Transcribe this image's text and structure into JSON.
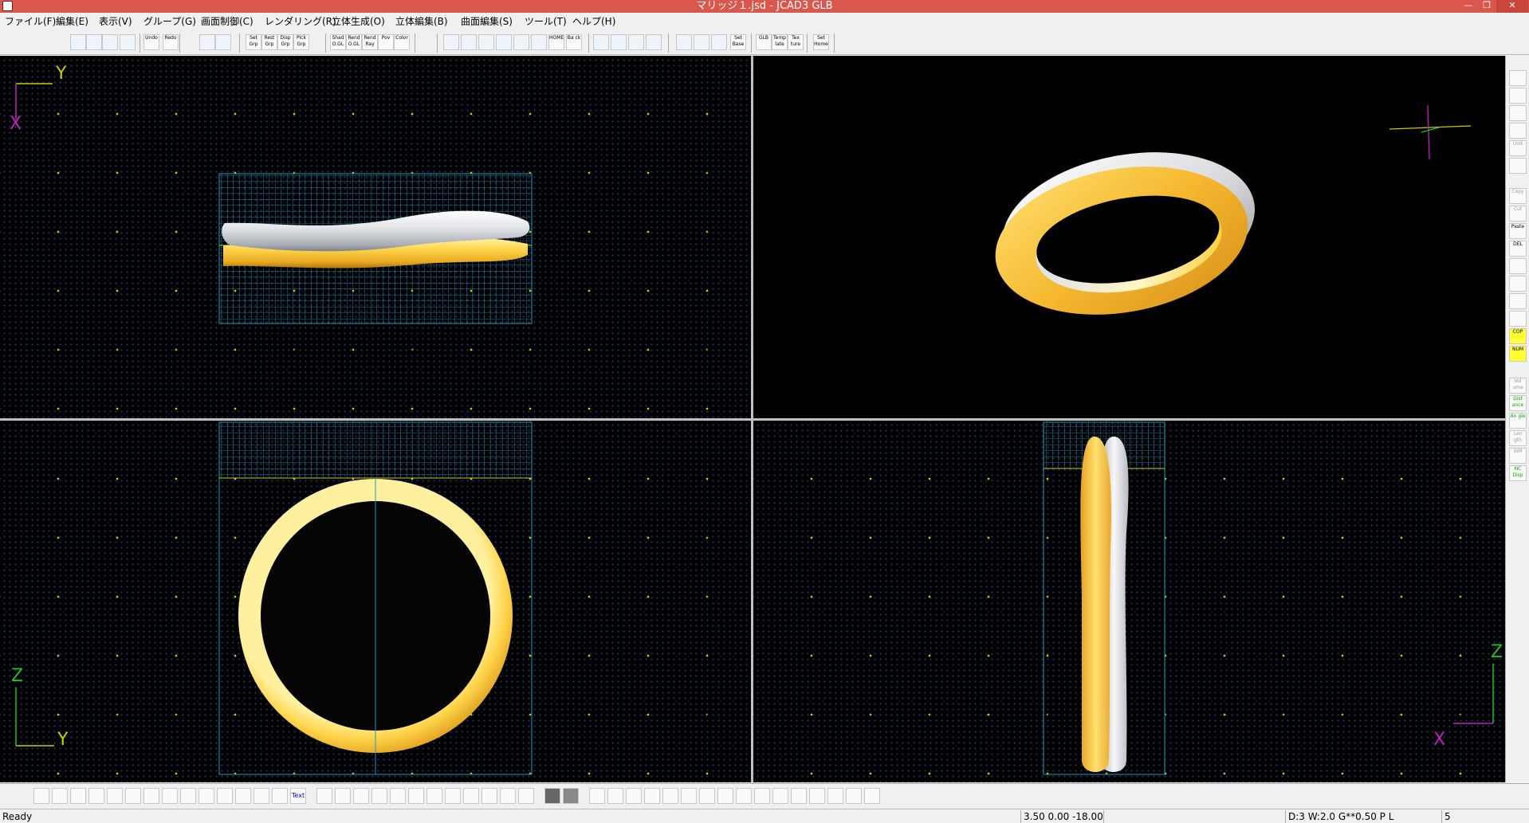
{
  "window": {
    "title": "マリッジ１.jsd - JCAD3 GLB",
    "controls": [
      "—",
      "❐",
      "✕"
    ]
  },
  "menu": [
    "ファイル(F)",
    "編集(E)",
    "表示(V)",
    "グループ(G)",
    "画面制御(C)",
    "レンダリング(R)",
    "立体生成(O)",
    "立体編集(B)",
    "曲面編集(S)",
    "ツール(T)",
    "ヘルプ(H)"
  ],
  "toolbar": [
    {
      "label": "",
      "icon": "new-file-icon"
    },
    {
      "label": "",
      "icon": "open-folder-icon"
    },
    {
      "label": "",
      "icon": "save-icon"
    },
    {
      "label": "",
      "icon": "print-icon"
    },
    {
      "label": "Undo",
      "icon": "undo-icon"
    },
    {
      "label": "Redo",
      "icon": "redo-icon"
    },
    {
      "label": "",
      "icon": "group-list-icon"
    },
    {
      "label": "",
      "icon": "group-table-icon"
    },
    {
      "label": "Set Grp",
      "icon": "set-group-icon"
    },
    {
      "label": "Rest Grp",
      "icon": "rest-group-icon"
    },
    {
      "label": "Disp Grp",
      "icon": "display-group-icon"
    },
    {
      "label": "Pick Grp",
      "icon": "pick-group-icon"
    },
    {
      "label": "Shad O.GL",
      "icon": "shade-opengl-icon"
    },
    {
      "label": "Rend O.GL",
      "icon": "render-opengl-icon"
    },
    {
      "label": "Rend Ray",
      "icon": "render-raytrace-icon"
    },
    {
      "label": "Pov",
      "icon": "pov-icon"
    },
    {
      "label": "Color",
      "icon": "color-icon"
    },
    {
      "label": "",
      "icon": "zoom-in-icon"
    },
    {
      "label": "",
      "icon": "zoom-out-icon"
    },
    {
      "label": "",
      "icon": "zoom-window-icon"
    },
    {
      "label": "",
      "icon": "zoom-all-icon"
    },
    {
      "label": "",
      "icon": "zoom-fit-icon"
    },
    {
      "label": "",
      "icon": "pan-hand-icon"
    },
    {
      "label": "HOME",
      "icon": "home-icon"
    },
    {
      "label": "Ba ck",
      "icon": "back-icon"
    },
    {
      "label": "",
      "icon": "zoom-3d-icon"
    },
    {
      "label": "",
      "icon": "zoom-3d-out-icon"
    },
    {
      "label": "",
      "icon": "zoom-3d-window-icon"
    },
    {
      "label": "",
      "icon": "zoom-3d-all-icon"
    },
    {
      "label": "",
      "icon": "grid-icon"
    },
    {
      "label": "",
      "icon": "grid-snap-icon"
    },
    {
      "label": "",
      "icon": "grid-color-icon"
    },
    {
      "label": "Set Base",
      "icon": "set-base-icon"
    },
    {
      "label": "GLB",
      "icon": "glb-icon"
    },
    {
      "label": "Temp late",
      "icon": "template-icon"
    },
    {
      "label": "Tex ture",
      "icon": "texture-icon"
    },
    {
      "label": "Set Home",
      "icon": "set-home-icon"
    }
  ],
  "viewports": {
    "top": {
      "axis_h": "Y",
      "axis_v": "X"
    },
    "front": {
      "axis_h": "Y",
      "axis_v": "Z"
    },
    "side": {
      "axis_h": "X",
      "axis_v": "Z"
    }
  },
  "right_tools": [
    {
      "label": "",
      "icon": "camera-icon"
    },
    {
      "label": "",
      "icon": "copy-view-icon"
    },
    {
      "label": "",
      "icon": "move-icon"
    },
    {
      "label": "",
      "icon": "eye-icon"
    },
    {
      "label": "Unit",
      "icon": "unit-icon"
    },
    {
      "label": "",
      "icon": "rotate-icon"
    },
    {
      "label": "Copy",
      "icon": "copy-icon"
    },
    {
      "label": "Cut",
      "icon": "cut-icon"
    },
    {
      "label": "Paste",
      "icon": "paste-icon"
    },
    {
      "label": "DEL",
      "icon": "delete-icon"
    },
    {
      "label": "",
      "icon": "image-icon"
    },
    {
      "label": "",
      "icon": "layer-icon"
    },
    {
      "label": "",
      "icon": "list-icon"
    },
    {
      "label": "",
      "icon": "keyboard-icon"
    },
    {
      "label": "COP",
      "icon": "cop-icon"
    },
    {
      "label": "NUM",
      "icon": "num-icon"
    },
    {
      "label": "Vol ume",
      "icon": "volume-icon"
    },
    {
      "label": "Dist ance",
      "icon": "distance-icon"
    },
    {
      "label": "An gle",
      "icon": "angle-icon"
    },
    {
      "label": "Len gth",
      "icon": "length-icon"
    },
    {
      "label": "SIM",
      "icon": "sim-icon"
    },
    {
      "label": "NC Disp",
      "icon": "nc-display-icon"
    }
  ],
  "bottom_tools": [
    {
      "label": "",
      "icon": "curve-point-icon"
    },
    {
      "label": "",
      "icon": "curve-spline-icon"
    },
    {
      "label": "",
      "icon": "curve-arc-icon"
    },
    {
      "label": "",
      "icon": "curve-circle-icon"
    },
    {
      "label": "",
      "icon": "curve-ellipse-icon"
    },
    {
      "label": "",
      "icon": "curve-line-icon"
    },
    {
      "label": "",
      "icon": "curve-offset-icon"
    },
    {
      "label": "",
      "icon": "curve-mirror-icon"
    },
    {
      "label": "",
      "icon": "curve-array-icon"
    },
    {
      "label": "",
      "icon": "curve-wave-icon"
    },
    {
      "label": "",
      "icon": "curve-rotate-icon"
    },
    {
      "label": "",
      "icon": "curve-scale-icon"
    },
    {
      "label": "",
      "icon": "curve-trim-icon"
    },
    {
      "label": "",
      "icon": "curve-join-icon"
    },
    {
      "label": "Text",
      "icon": "text-icon"
    },
    {
      "label": "",
      "icon": "point-edit-icon"
    },
    {
      "label": "",
      "icon": "point-move-icon"
    },
    {
      "label": "",
      "icon": "point-add-icon"
    },
    {
      "label": "",
      "icon": "point-delete-icon"
    },
    {
      "label": "",
      "icon": "point-select-icon"
    },
    {
      "label": "",
      "icon": "point-rotate-icon"
    },
    {
      "label": "",
      "icon": "point-scale-icon"
    },
    {
      "label": "",
      "icon": "point-mirror-icon"
    },
    {
      "label": "",
      "icon": "point-align-icon"
    },
    {
      "label": "",
      "icon": "point-snap-icon"
    },
    {
      "label": "",
      "icon": "point-lock-icon"
    },
    {
      "label": "",
      "icon": "point-grid-icon"
    },
    {
      "label": "",
      "icon": "fill-dark-icon"
    },
    {
      "label": "",
      "icon": "fill-gray-icon"
    },
    {
      "label": "",
      "icon": "solid-sphere-icon"
    },
    {
      "label": "",
      "icon": "solid-extrude-icon"
    },
    {
      "label": "",
      "icon": "solid-revolve-icon"
    },
    {
      "label": "",
      "icon": "solid-sweep-icon"
    },
    {
      "label": "",
      "icon": "solid-loft-icon"
    },
    {
      "label": "",
      "icon": "solid-ring-icon"
    },
    {
      "label": "",
      "icon": "solid-bend-icon"
    },
    {
      "label": "",
      "icon": "solid-twist-icon"
    },
    {
      "label": "",
      "icon": "solid-taper-icon"
    },
    {
      "label": "",
      "icon": "solid-shell-icon"
    },
    {
      "label": "",
      "icon": "solid-boolean-icon"
    },
    {
      "label": "",
      "icon": "solid-mirror-icon"
    },
    {
      "label": "",
      "icon": "solid-array-icon"
    },
    {
      "label": "",
      "icon": "solid-cut-icon"
    },
    {
      "label": "",
      "icon": "solid-fillet-icon"
    },
    {
      "label": "",
      "icon": "solid-measure-icon"
    }
  ],
  "status": {
    "message": "Ready",
    "coords": "3.50 0.00 -18.00",
    "mode": "D:3 W:2.0  G**0.50 P   L",
    "count": "5"
  },
  "colors": {
    "titlebar": "#d9574d",
    "gold": "#f5c038",
    "silver": "#c8cad0",
    "grid_blue": "#1e9bbf",
    "grid_yellow": "#cccc00"
  }
}
